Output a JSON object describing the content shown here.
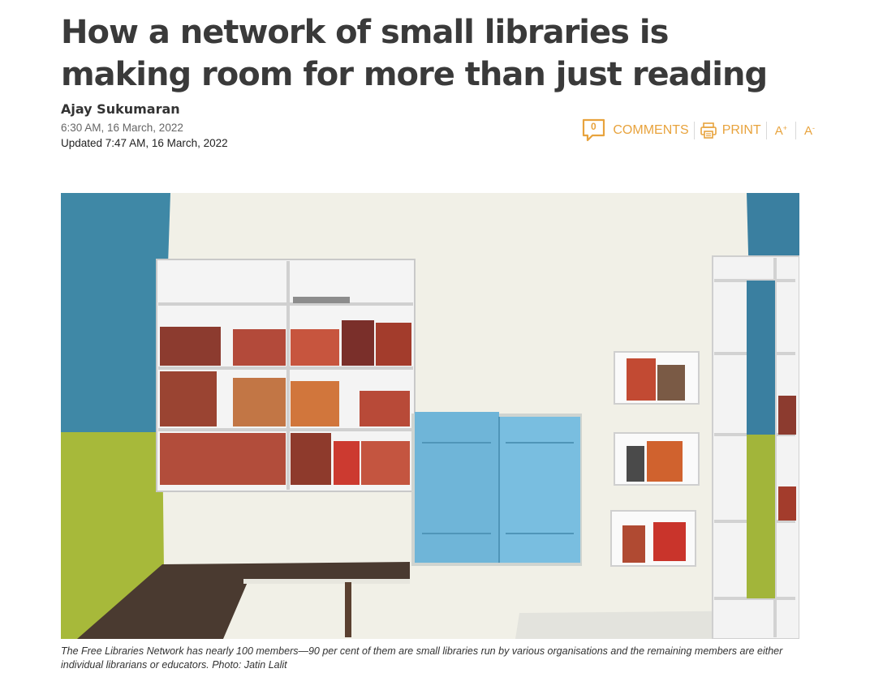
{
  "article": {
    "headline": "How a network of small libraries is making room for more than just reading",
    "author": "Ajay Sukumaran",
    "published": "6:30 AM, 16 March, 2022",
    "updated": "Updated 7:47 AM, 16 March, 2022"
  },
  "toolbar": {
    "comment_count": "0",
    "comments_label": "COMMENTS",
    "print_label": "PRINT",
    "font_increase_label": "A",
    "font_increase_mark": "+",
    "font_decrease_label": "A",
    "font_decrease_mark": "-",
    "accent_color": "#e8a33d"
  },
  "photo": {
    "caption": "The Free Libraries Network has nearly 100 members—90 per cent of them are small libraries run by various organisations and the remaining members are either individual librarians or educators. Photo: Jatin Lalit"
  }
}
